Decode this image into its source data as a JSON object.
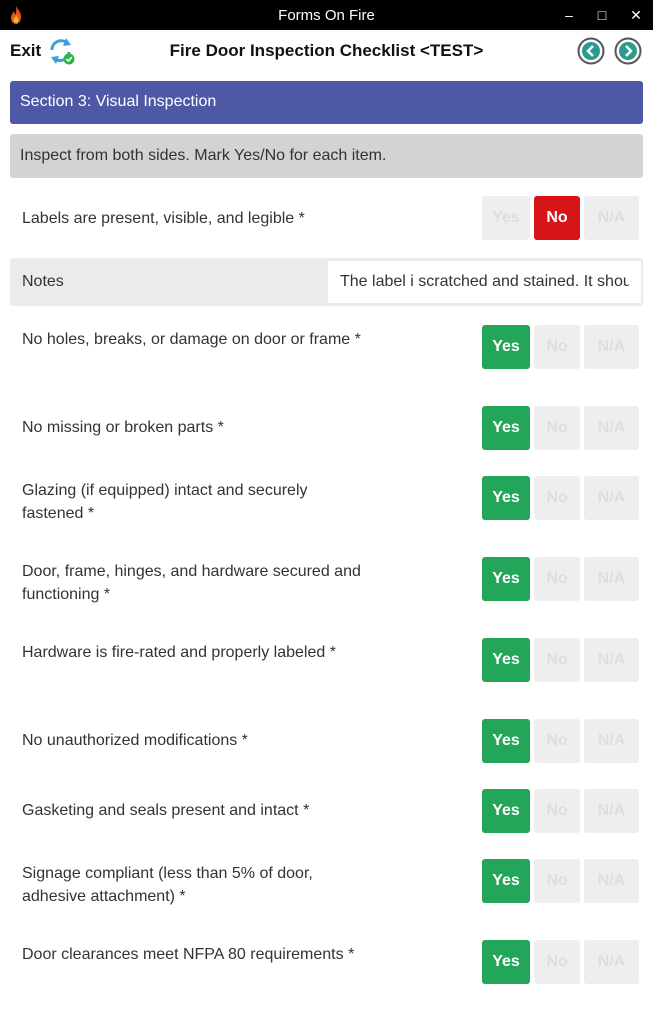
{
  "window": {
    "title": "Forms On Fire",
    "controls": {
      "minimize": "–",
      "maximize": "□",
      "close": "✕"
    }
  },
  "header": {
    "exit_label": "Exit",
    "form_title": "Fire Door Inspection Checklist <TEST>"
  },
  "section": {
    "title": "Section 3: Visual Inspection",
    "instructions": "Inspect from both sides. Mark Yes/No for each item."
  },
  "options": {
    "yes": "Yes",
    "no": "No",
    "na": "N/A"
  },
  "questions": [
    {
      "label": "Labels are present, visible, and legible *",
      "selected": "no"
    },
    {
      "label": "No holes, breaks, or damage on door or frame *",
      "selected": "yes"
    },
    {
      "label": "No missing or broken parts *",
      "selected": "yes"
    },
    {
      "label": "Glazing (if equipped) intact and securely fastened *",
      "selected": "yes"
    },
    {
      "label": "Door, frame, hinges, and hardware secured and functioning *",
      "selected": "yes"
    },
    {
      "label": "Hardware is fire-rated and properly labeled *",
      "selected": "yes"
    },
    {
      "label": "No unauthorized modifications *",
      "selected": "yes"
    },
    {
      "label": "Gasketing and seals present and intact *",
      "selected": "yes"
    },
    {
      "label": "Signage compliant (less than 5% of door, adhesive attachment) *",
      "selected": "yes"
    },
    {
      "label": "Door clearances meet NFPA 80 requirements *",
      "selected": "yes"
    }
  ],
  "notes": {
    "label": "Notes",
    "value": "The label i scratched and stained. It should be replaced."
  },
  "colors": {
    "title_bar": "#000000",
    "section_bar": "#4e59a6",
    "info_bar": "#d3d3d3",
    "yes_selected": "#23a55a",
    "no_selected": "#d71417",
    "unselected": "#eeeeee",
    "nav_accent": "#2a9b8c"
  }
}
